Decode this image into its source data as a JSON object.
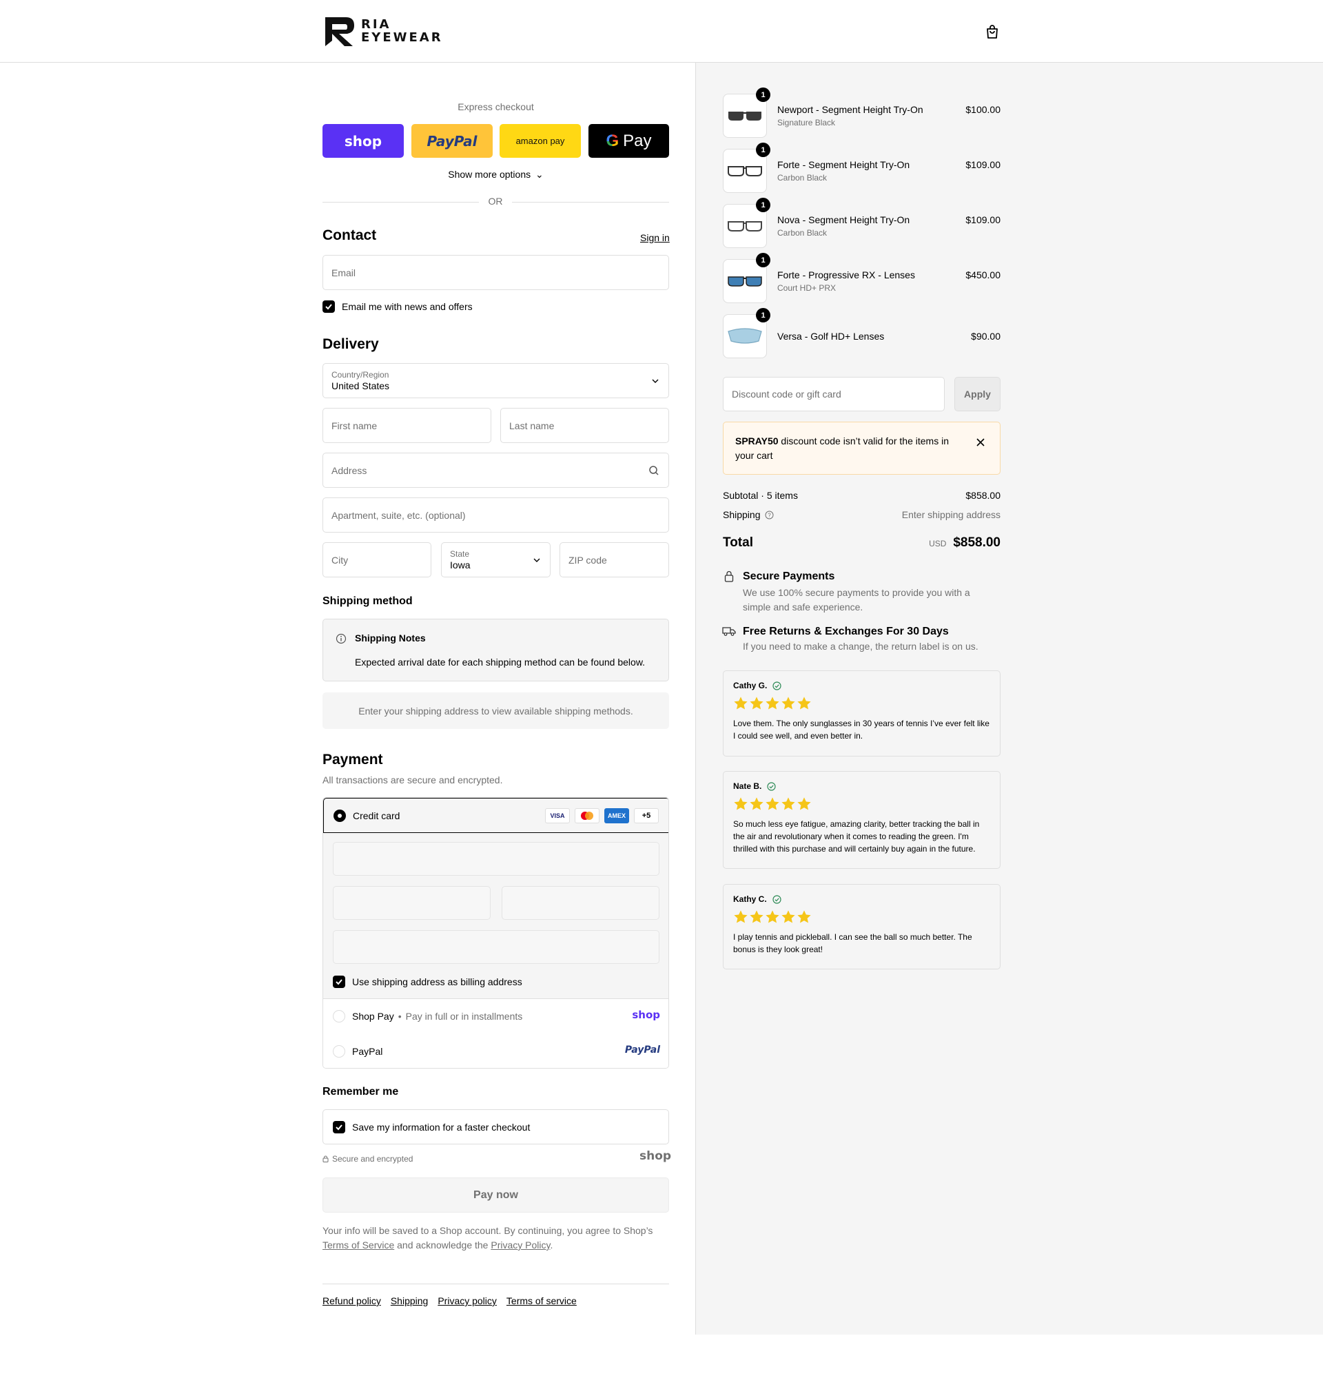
{
  "brand": {
    "line1": "RIA",
    "line2": "EYEWEAR"
  },
  "express": {
    "title": "Express checkout",
    "shop_label": "shop",
    "paypal_label": "PayPal",
    "amazon_label": "amazon pay",
    "gpay_label": "Pay",
    "more_options": "Show more options",
    "or": "OR"
  },
  "contact": {
    "title": "Contact",
    "sign_in": "Sign in",
    "email_placeholder": "Email",
    "news_label": "Email me with news and offers"
  },
  "delivery": {
    "title": "Delivery",
    "country_label": "Country/Region",
    "country_value": "United States",
    "first_name": "First name",
    "last_name": "Last name",
    "address": "Address",
    "apartment": "Apartment, suite, etc. (optional)",
    "city": "City",
    "state_label": "State",
    "state_value": "Iowa",
    "zip": "ZIP code"
  },
  "shipping": {
    "title": "Shipping method",
    "notes_title": "Shipping Notes",
    "notes_body": "Expected arrival date for each shipping method can be found below.",
    "empty": "Enter your shipping address to view available shipping methods."
  },
  "payment": {
    "title": "Payment",
    "subtitle": "All transactions are secure and encrypted.",
    "credit_card": "Credit card",
    "cards": {
      "visa": "VISA",
      "amex": "AMEX",
      "more": "+5"
    },
    "billing_label": "Use shipping address as billing address",
    "shop_pay": "Shop Pay",
    "shop_pay_sub": "Pay in full or in installments",
    "shop_logo": "shop",
    "paypal": "PayPal",
    "paypal_logo": "PayPal"
  },
  "remember": {
    "title": "Remember me",
    "save_label": "Save my information for a faster checkout",
    "secure": "Secure and encrypted",
    "shop_logo": "shop"
  },
  "pay_now": "Pay now",
  "legal": {
    "text1": "Your info will be saved to a Shop account. By continuing, you agree to Shop’s",
    "terms": "Terms of Service",
    "text2": "and acknowledge the",
    "privacy": "Privacy Policy",
    "end": "."
  },
  "footer": [
    "Refund policy",
    "Shipping",
    "Privacy policy",
    "Terms of service"
  ],
  "cart": {
    "items": [
      {
        "name": "Newport - Segment Height Try-On",
        "variant": "Signature Black",
        "price": "$100.00",
        "qty": "1",
        "lens_color": "#3a3a3a"
      },
      {
        "name": "Forte - Segment Height Try-On",
        "variant": "Carbon Black",
        "price": "$109.00",
        "qty": "1",
        "lens_color": "#ffffff"
      },
      {
        "name": "Nova - Segment Height Try-On",
        "variant": "Carbon Black",
        "price": "$109.00",
        "qty": "1",
        "lens_color": "#ffffff"
      },
      {
        "name": "Forte - Progressive RX - Lenses",
        "variant": "Court HD+ PRX",
        "price": "$450.00",
        "qty": "1",
        "lens_color": "#3f7fb5"
      },
      {
        "name": "Versa - Golf HD+ Lenses",
        "variant": "",
        "price": "$90.00",
        "qty": "1",
        "lens_color": "#a9cfe3"
      }
    ],
    "discount_placeholder": "Discount code or gift card",
    "apply": "Apply",
    "warning_code": "SPRAY50",
    "warning_text": " discount code isn’t valid for the items in your cart",
    "subtotal_label": "Subtotal · 5 items",
    "subtotal_value": "$858.00",
    "shipping_label": "Shipping",
    "shipping_value": "Enter shipping address",
    "total_label": "Total",
    "currency": "USD",
    "total_value": "$858.00"
  },
  "trust": {
    "secure_title": "Secure Payments",
    "secure_body": "We use 100% secure payments to provide you with a simple and safe experience.",
    "returns_title": "Free Returns & Exchanges For 30 Days",
    "returns_body": "If you need to make a change, the return label is on us."
  },
  "reviews": [
    {
      "name": "Cathy G.",
      "rating": 5,
      "body": "Love them. The only sunglasses in 30 years of tennis I’ve ever felt like I could see well, and even better in."
    },
    {
      "name": "Nate B.",
      "rating": 5,
      "body": "So much less eye fatigue, amazing clarity, better tracking the ball in the air and revolutionary when it comes to reading the green. I'm thrilled with this purchase and will certainly buy again in the future."
    },
    {
      "name": "Kathy C.",
      "rating": 5,
      "body": "I play tennis and pickleball. I can see the ball so much better. The bonus is they look great!"
    }
  ],
  "colors": {
    "accent": "#000000",
    "star": "#f5c518",
    "shop": "#5a31f4",
    "paypal_yellow": "#ffc439",
    "amazon_yellow": "#ffd814",
    "warning_bg": "#fff8ef",
    "panel": "#f5f5f5"
  }
}
